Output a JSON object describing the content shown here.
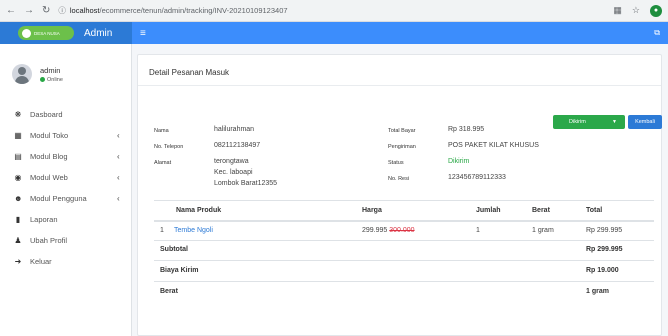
{
  "browser": {
    "url_host": "localhost",
    "url_path": "/ecommerce/tenun/admin/tracking/INV-20210109123407"
  },
  "header": {
    "brand_logo_text": "DESA NUSA",
    "brand_name": "Admin"
  },
  "user": {
    "name": "admin",
    "status": "Online"
  },
  "sidebar": {
    "items": [
      {
        "label": "Dasboard",
        "has_children": false
      },
      {
        "label": "Modul Toko",
        "has_children": true
      },
      {
        "label": "Modul Blog",
        "has_children": true
      },
      {
        "label": "Modul Web",
        "has_children": true
      },
      {
        "label": "Modul Pengguna",
        "has_children": true
      },
      {
        "label": "Laporan",
        "has_children": false
      },
      {
        "label": "Ubah Profil",
        "has_children": false
      },
      {
        "label": "Keluar",
        "has_children": false
      }
    ]
  },
  "card": {
    "title": "Detail Pesanan Masuk",
    "kirim_label": "Dikirim",
    "kembali_label": "Kembali"
  },
  "order": {
    "nama_label": "Nama",
    "nama": "halilurahman",
    "telepon_label": "No. Telepon",
    "telepon": "082112138497",
    "alamat_label": "Alamat",
    "alamat_1": "terongtawa",
    "alamat_2": "Kec. laboapi",
    "alamat_3": "Lombok Barat12355",
    "total_bayar_label": "Total Bayar",
    "total_bayar": "Rp 318.995",
    "pengiriman_label": "Pengiriman",
    "pengiriman": "POS PAKET KILAT KHUSUS",
    "status_label": "Status",
    "status": "Dikirim",
    "resi_label": "No. Resi",
    "resi": "123456789112333"
  },
  "table": {
    "headers": [
      "Nama Produk",
      "Harga",
      "Jumlah",
      "Berat",
      "Total"
    ],
    "rows": [
      {
        "no": "1",
        "produk": "Tembe Ngoli",
        "harga": "299.995",
        "harga_coret": "300.000",
        "jumlah": "1",
        "berat": "1 gram",
        "total": "Rp 299.995"
      }
    ],
    "subtotal_label": "Subtotal",
    "subtotal": "Rp 299.995",
    "biaya_kirim_label": "Biaya Kirim",
    "biaya_kirim": "Rp 19.000",
    "berat_label": "Berat",
    "berat": "1 gram"
  },
  "colors": {
    "brand": "#2c7ad6",
    "navbar": "#3c8dfc",
    "success": "#2ba84a",
    "danger": "#dc3545"
  }
}
